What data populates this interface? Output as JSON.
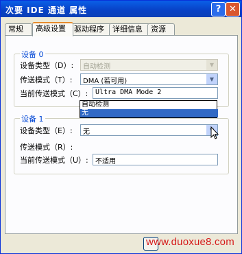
{
  "window": {
    "title": "次要 IDE 通道 属性",
    "help": "?",
    "close": "✕"
  },
  "tabs": [
    {
      "label": "常规"
    },
    {
      "label": "高级设置"
    },
    {
      "label": "驱动程序"
    },
    {
      "label": "详细信息"
    },
    {
      "label": "资源"
    }
  ],
  "device0": {
    "legend": "设备 0",
    "type_label": "设备类型（D）:",
    "type_value": "自动检测",
    "mode_label": "传送模式（T）:",
    "mode_value": "DMA (若可用)",
    "current_label": "当前传送模式（C）:",
    "current_value": "Ultra DMA Mode 2"
  },
  "device1": {
    "legend": "设备 1",
    "type_label": "设备类型（E）:",
    "type_value": "无",
    "mode_label": "传送模式（R）:",
    "current_label": "当前传送模式（U）:",
    "current_value": "不适用",
    "dropdown_options": [
      {
        "label": "自动检测",
        "selected": false
      },
      {
        "label": "无",
        "selected": true
      }
    ]
  },
  "watermark": "www.duoxue8.com"
}
